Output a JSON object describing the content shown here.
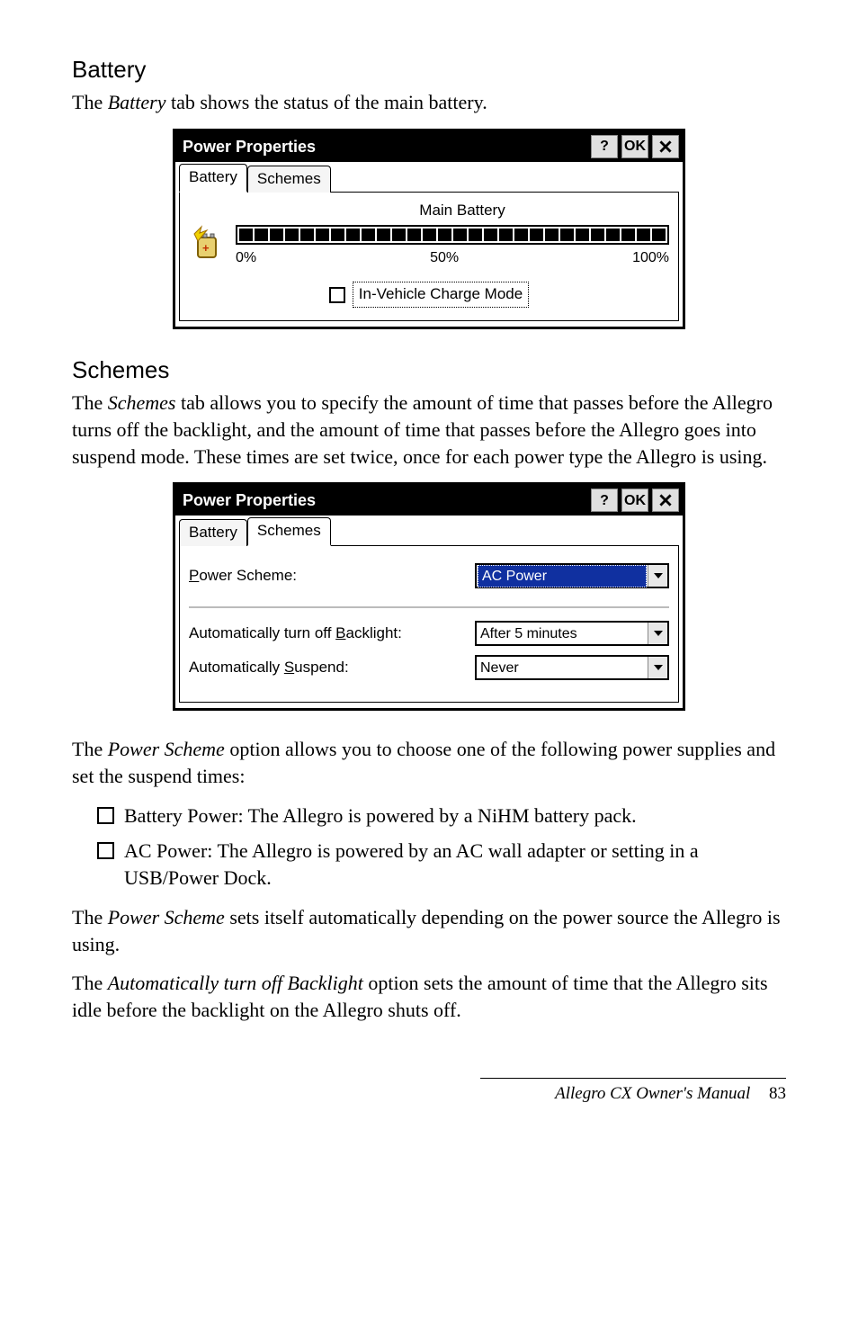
{
  "section1": {
    "heading": "Battery",
    "intro_pre": "The ",
    "intro_em": "Battery",
    "intro_post": " tab shows the status of the main battery."
  },
  "dialog1": {
    "title": "Power Properties",
    "btn_help": "?",
    "btn_ok": "OK",
    "tab_battery": "Battery",
    "tab_schemes": "Schemes",
    "main_battery_label": "Main Battery",
    "pct0": "0%",
    "pct50": "50%",
    "pct100": "100%",
    "checkbox_label": "In-Vehicle Charge Mode"
  },
  "section2": {
    "heading": "Schemes",
    "intro_pre": "The ",
    "intro_em": "Schemes",
    "intro_post": " tab allows you to specify the amount of time that passes before the Allegro turns off the backlight, and the amount of time that passes before the Allegro goes into suspend mode. These times are set twice, once for each power type the Allegro is using."
  },
  "dialog2": {
    "title": "Power Properties",
    "btn_help": "?",
    "btn_ok": "OK",
    "tab_battery": "Battery",
    "tab_schemes": "Schemes",
    "power_scheme_label_pre": "P",
    "power_scheme_label_post": "ower Scheme:",
    "power_scheme_value": "AC Power",
    "backlight_label_pre": "Automatically turn off ",
    "backlight_label_u": "B",
    "backlight_label_post": "acklight:",
    "backlight_value": "After 5 minutes",
    "suspend_label_pre": "Automatically ",
    "suspend_label_u": "S",
    "suspend_label_post": "uspend:",
    "suspend_value": "Never"
  },
  "para_scheme_option_pre": "The ",
  "para_scheme_option_em": "Power Scheme",
  "para_scheme_option_post": " option allows you to choose one of the following power supplies and set the suspend times:",
  "bullet1": "Battery Power: The Allegro is powered by a NiHM battery pack.",
  "bullet2": "AC Power: The Allegro is powered by an AC wall adapter or setting in a USB/Power Dock.",
  "para_sets_pre": "The ",
  "para_sets_em": "Power Scheme",
  "para_sets_post": " sets itself automatically depending on the power source the Allegro is using.",
  "para_auto_pre": "The ",
  "para_auto_em": "Automatically turn off Backlight",
  "para_auto_post": " option sets the amount of time that the Allegro sits idle before the backlight on the Allegro shuts off.",
  "footer_text": "Allegro CX Owner's Manual",
  "footer_page": "83"
}
